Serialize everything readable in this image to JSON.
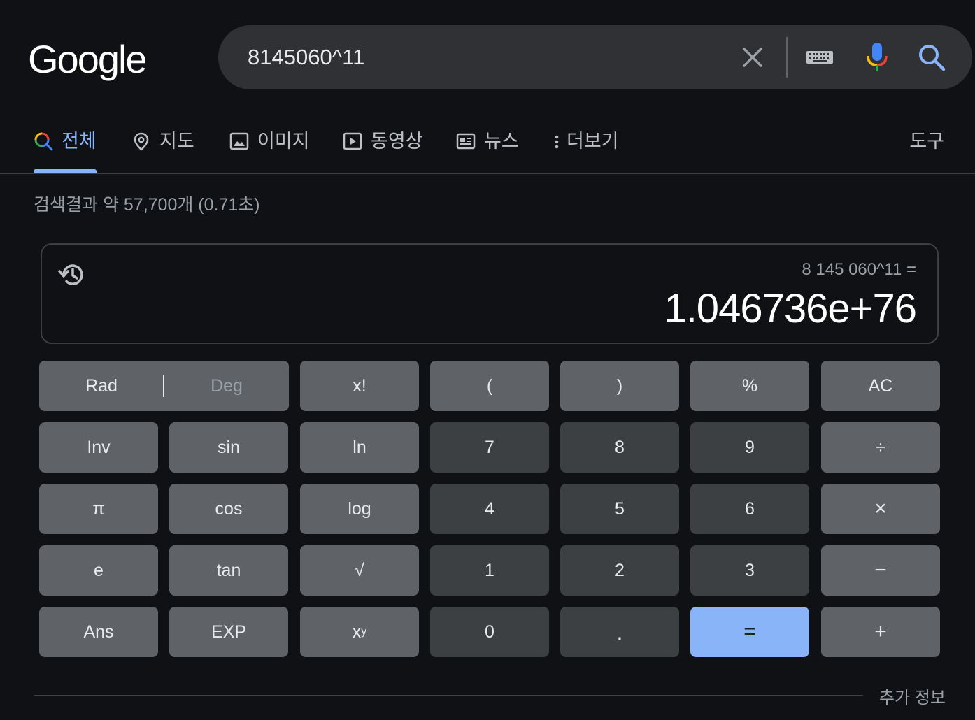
{
  "logo": "Google",
  "search": {
    "value": "8145060^11"
  },
  "tabs": [
    {
      "label": "전체",
      "icon": "search-icon"
    },
    {
      "label": "지도",
      "icon": "map-pin-icon"
    },
    {
      "label": "이미지",
      "icon": "image-icon"
    },
    {
      "label": "동영상",
      "icon": "video-icon"
    },
    {
      "label": "뉴스",
      "icon": "news-icon"
    },
    {
      "label": "더보기",
      "icon": "more-vert-icon"
    }
  ],
  "tools_label": "도구",
  "stats": "검색결과 약 57,700개 (0.71초)",
  "calculator": {
    "expression": "8 145 060^11 =",
    "result": "1.046736e+76",
    "rad_label": "Rad",
    "deg_label": "Deg",
    "keys": {
      "fact": "x!",
      "lparen": "(",
      "rparen": ")",
      "percent": "%",
      "ac": "AC",
      "inv": "Inv",
      "sin": "sin",
      "ln": "ln",
      "seven": "7",
      "eight": "8",
      "nine": "9",
      "divide": "÷",
      "pi": "π",
      "cos": "cos",
      "log": "log",
      "four": "4",
      "five": "5",
      "six": "6",
      "multiply": "×",
      "e": "e",
      "tan": "tan",
      "sqrt": "√",
      "one": "1",
      "two": "2",
      "three": "3",
      "minus": "−",
      "ans": "Ans",
      "exp": "EXP",
      "pow_base": "x",
      "pow_exp": "y",
      "zero": "0",
      "dot": ".",
      "equals": "=",
      "plus": "+"
    }
  },
  "more_info": "추가 정보",
  "colors": {
    "accent": "#8ab4f8",
    "fn_key": "#5f6368",
    "num_key": "#3c4043",
    "background": "#101114"
  }
}
